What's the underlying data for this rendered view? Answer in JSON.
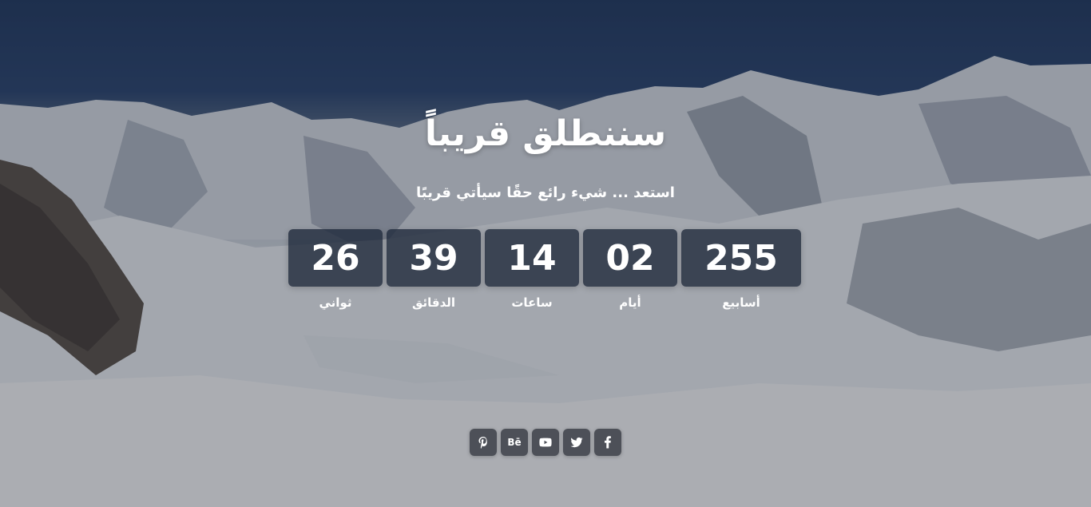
{
  "hero": {
    "title": "سننطلق قريباً",
    "subtitle": "استعد ... شيء رائع حقًا سيأتي قريبًا"
  },
  "countdown": {
    "units": [
      {
        "value": "255",
        "label": "أسابيع"
      },
      {
        "value": "02",
        "label": "أيام"
      },
      {
        "value": "14",
        "label": "ساعات"
      },
      {
        "value": "39",
        "label": "الدقائق"
      },
      {
        "value": "26",
        "label": "ثواني"
      }
    ]
  },
  "social": {
    "icons": [
      "pinterest-icon",
      "behance-icon",
      "youtube-icon",
      "twitter-icon",
      "facebook-icon"
    ],
    "behance_text": "Bē"
  },
  "colors": {
    "text": "#ffffff",
    "counter_box": "#1e283a",
    "social_button": "#282c34"
  }
}
